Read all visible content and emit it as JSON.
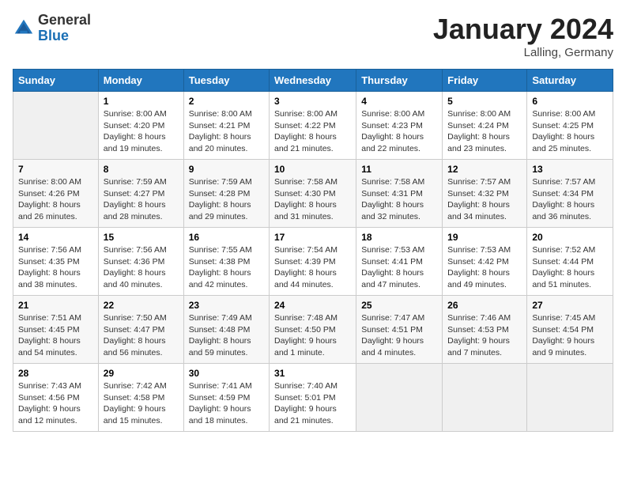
{
  "header": {
    "logo_general": "General",
    "logo_blue": "Blue",
    "month": "January 2024",
    "location": "Lalling, Germany"
  },
  "columns": [
    "Sunday",
    "Monday",
    "Tuesday",
    "Wednesday",
    "Thursday",
    "Friday",
    "Saturday"
  ],
  "weeks": [
    [
      {
        "day": "",
        "empty": true
      },
      {
        "day": "1",
        "sunrise": "Sunrise: 8:00 AM",
        "sunset": "Sunset: 4:20 PM",
        "daylight": "Daylight: 8 hours and 19 minutes."
      },
      {
        "day": "2",
        "sunrise": "Sunrise: 8:00 AM",
        "sunset": "Sunset: 4:21 PM",
        "daylight": "Daylight: 8 hours and 20 minutes."
      },
      {
        "day": "3",
        "sunrise": "Sunrise: 8:00 AM",
        "sunset": "Sunset: 4:22 PM",
        "daylight": "Daylight: 8 hours and 21 minutes."
      },
      {
        "day": "4",
        "sunrise": "Sunrise: 8:00 AM",
        "sunset": "Sunset: 4:23 PM",
        "daylight": "Daylight: 8 hours and 22 minutes."
      },
      {
        "day": "5",
        "sunrise": "Sunrise: 8:00 AM",
        "sunset": "Sunset: 4:24 PM",
        "daylight": "Daylight: 8 hours and 23 minutes."
      },
      {
        "day": "6",
        "sunrise": "Sunrise: 8:00 AM",
        "sunset": "Sunset: 4:25 PM",
        "daylight": "Daylight: 8 hours and 25 minutes."
      }
    ],
    [
      {
        "day": "7",
        "sunrise": "Sunrise: 8:00 AM",
        "sunset": "Sunset: 4:26 PM",
        "daylight": "Daylight: 8 hours and 26 minutes."
      },
      {
        "day": "8",
        "sunrise": "Sunrise: 7:59 AM",
        "sunset": "Sunset: 4:27 PM",
        "daylight": "Daylight: 8 hours and 28 minutes."
      },
      {
        "day": "9",
        "sunrise": "Sunrise: 7:59 AM",
        "sunset": "Sunset: 4:28 PM",
        "daylight": "Daylight: 8 hours and 29 minutes."
      },
      {
        "day": "10",
        "sunrise": "Sunrise: 7:58 AM",
        "sunset": "Sunset: 4:30 PM",
        "daylight": "Daylight: 8 hours and 31 minutes."
      },
      {
        "day": "11",
        "sunrise": "Sunrise: 7:58 AM",
        "sunset": "Sunset: 4:31 PM",
        "daylight": "Daylight: 8 hours and 32 minutes."
      },
      {
        "day": "12",
        "sunrise": "Sunrise: 7:57 AM",
        "sunset": "Sunset: 4:32 PM",
        "daylight": "Daylight: 8 hours and 34 minutes."
      },
      {
        "day": "13",
        "sunrise": "Sunrise: 7:57 AM",
        "sunset": "Sunset: 4:34 PM",
        "daylight": "Daylight: 8 hours and 36 minutes."
      }
    ],
    [
      {
        "day": "14",
        "sunrise": "Sunrise: 7:56 AM",
        "sunset": "Sunset: 4:35 PM",
        "daylight": "Daylight: 8 hours and 38 minutes."
      },
      {
        "day": "15",
        "sunrise": "Sunrise: 7:56 AM",
        "sunset": "Sunset: 4:36 PM",
        "daylight": "Daylight: 8 hours and 40 minutes."
      },
      {
        "day": "16",
        "sunrise": "Sunrise: 7:55 AM",
        "sunset": "Sunset: 4:38 PM",
        "daylight": "Daylight: 8 hours and 42 minutes."
      },
      {
        "day": "17",
        "sunrise": "Sunrise: 7:54 AM",
        "sunset": "Sunset: 4:39 PM",
        "daylight": "Daylight: 8 hours and 44 minutes."
      },
      {
        "day": "18",
        "sunrise": "Sunrise: 7:53 AM",
        "sunset": "Sunset: 4:41 PM",
        "daylight": "Daylight: 8 hours and 47 minutes."
      },
      {
        "day": "19",
        "sunrise": "Sunrise: 7:53 AM",
        "sunset": "Sunset: 4:42 PM",
        "daylight": "Daylight: 8 hours and 49 minutes."
      },
      {
        "day": "20",
        "sunrise": "Sunrise: 7:52 AM",
        "sunset": "Sunset: 4:44 PM",
        "daylight": "Daylight: 8 hours and 51 minutes."
      }
    ],
    [
      {
        "day": "21",
        "sunrise": "Sunrise: 7:51 AM",
        "sunset": "Sunset: 4:45 PM",
        "daylight": "Daylight: 8 hours and 54 minutes."
      },
      {
        "day": "22",
        "sunrise": "Sunrise: 7:50 AM",
        "sunset": "Sunset: 4:47 PM",
        "daylight": "Daylight: 8 hours and 56 minutes."
      },
      {
        "day": "23",
        "sunrise": "Sunrise: 7:49 AM",
        "sunset": "Sunset: 4:48 PM",
        "daylight": "Daylight: 8 hours and 59 minutes."
      },
      {
        "day": "24",
        "sunrise": "Sunrise: 7:48 AM",
        "sunset": "Sunset: 4:50 PM",
        "daylight": "Daylight: 9 hours and 1 minute."
      },
      {
        "day": "25",
        "sunrise": "Sunrise: 7:47 AM",
        "sunset": "Sunset: 4:51 PM",
        "daylight": "Daylight: 9 hours and 4 minutes."
      },
      {
        "day": "26",
        "sunrise": "Sunrise: 7:46 AM",
        "sunset": "Sunset: 4:53 PM",
        "daylight": "Daylight: 9 hours and 7 minutes."
      },
      {
        "day": "27",
        "sunrise": "Sunrise: 7:45 AM",
        "sunset": "Sunset: 4:54 PM",
        "daylight": "Daylight: 9 hours and 9 minutes."
      }
    ],
    [
      {
        "day": "28",
        "sunrise": "Sunrise: 7:43 AM",
        "sunset": "Sunset: 4:56 PM",
        "daylight": "Daylight: 9 hours and 12 minutes."
      },
      {
        "day": "29",
        "sunrise": "Sunrise: 7:42 AM",
        "sunset": "Sunset: 4:58 PM",
        "daylight": "Daylight: 9 hours and 15 minutes."
      },
      {
        "day": "30",
        "sunrise": "Sunrise: 7:41 AM",
        "sunset": "Sunset: 4:59 PM",
        "daylight": "Daylight: 9 hours and 18 minutes."
      },
      {
        "day": "31",
        "sunrise": "Sunrise: 7:40 AM",
        "sunset": "Sunset: 5:01 PM",
        "daylight": "Daylight: 9 hours and 21 minutes."
      },
      {
        "day": "",
        "empty": true
      },
      {
        "day": "",
        "empty": true
      },
      {
        "day": "",
        "empty": true
      }
    ]
  ]
}
